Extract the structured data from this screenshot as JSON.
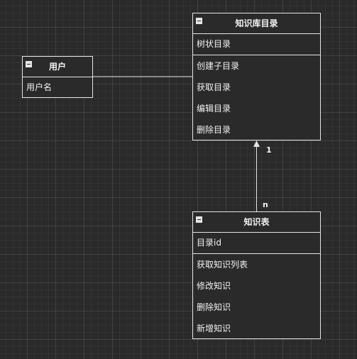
{
  "classes": {
    "catalog": {
      "name": "知识库目录",
      "attribute": "树状目录",
      "operations": [
        "创建子目录",
        "获取目录",
        "编辑目录",
        "删除目录"
      ]
    },
    "user": {
      "name": "用户",
      "attribute": "用户名"
    },
    "knowledge": {
      "name": "知识表",
      "attribute": "目录id",
      "operations": [
        "获取知识列表",
        "修改知识",
        "删除知识",
        "新增知识"
      ]
    }
  },
  "relations": {
    "knowledge_to_catalog": {
      "source_multiplicity": "n",
      "target_multiplicity": "1"
    }
  }
}
